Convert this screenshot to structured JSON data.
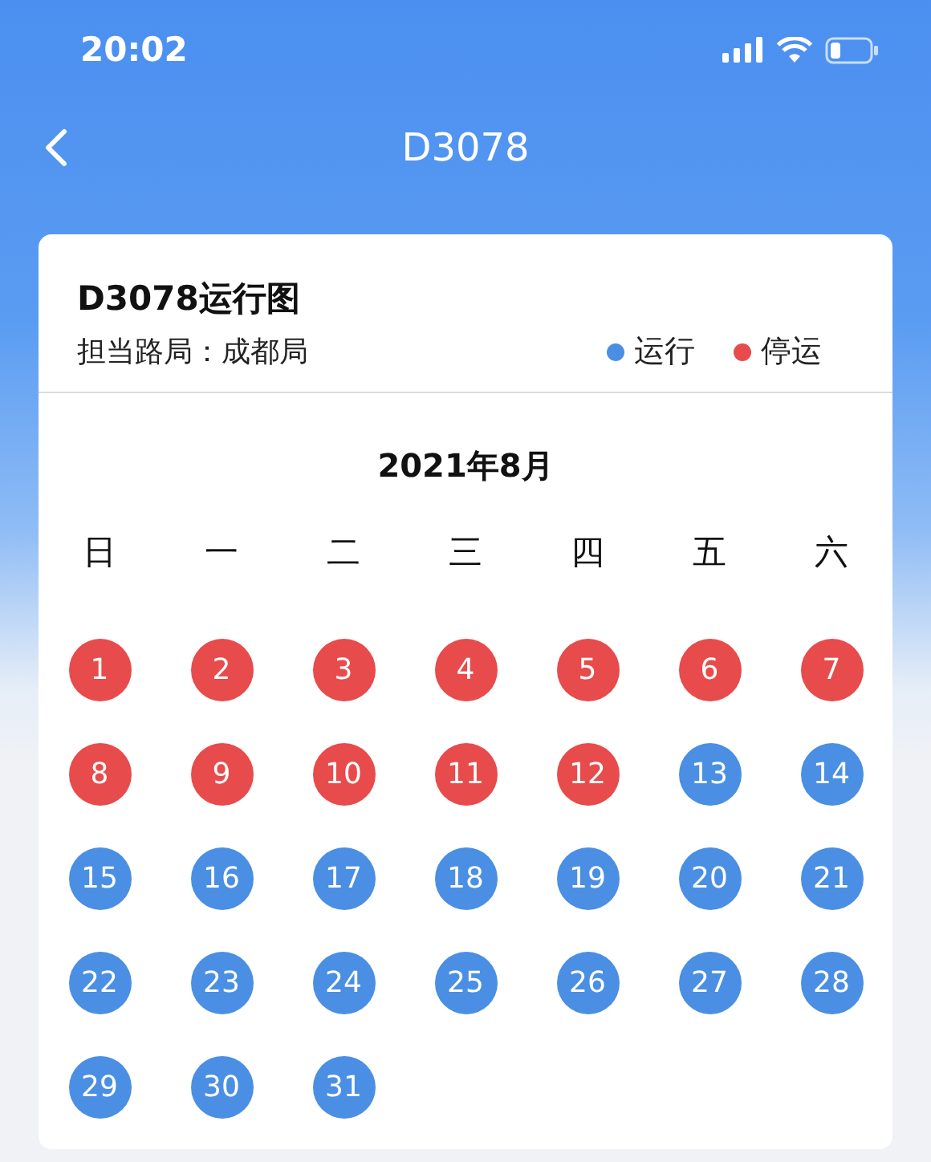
{
  "status_bar": {
    "time": "20:02"
  },
  "nav": {
    "title": "D3078"
  },
  "card": {
    "title": "D3078运行图",
    "bureau": "担当路局：成都局",
    "legend": [
      {
        "label": "运行",
        "color": "#4a8fe3"
      },
      {
        "label": "停运",
        "color": "#e84b4b"
      }
    ]
  },
  "calendar": {
    "month": "2021年8月",
    "weekdays": [
      "日",
      "一",
      "二",
      "三",
      "四",
      "五",
      "六"
    ],
    "days": [
      {
        "label": "1",
        "color": "#e84b4b"
      },
      {
        "label": "2",
        "color": "#e84b4b"
      },
      {
        "label": "3",
        "color": "#e84b4b"
      },
      {
        "label": "4",
        "color": "#e84b4b"
      },
      {
        "label": "5",
        "color": "#e84b4b"
      },
      {
        "label": "6",
        "color": "#e84b4b"
      },
      {
        "label": "7",
        "color": "#e84b4b"
      },
      {
        "label": "8",
        "color": "#e84b4b"
      },
      {
        "label": "9",
        "color": "#e84b4b"
      },
      {
        "label": "10",
        "color": "#e84b4b"
      },
      {
        "label": "11",
        "color": "#e84b4b"
      },
      {
        "label": "12",
        "color": "#e84b4b"
      },
      {
        "label": "13",
        "color": "#4a8fe3"
      },
      {
        "label": "14",
        "color": "#4a8fe3"
      },
      {
        "label": "15",
        "color": "#4a8fe3"
      },
      {
        "label": "16",
        "color": "#4a8fe3"
      },
      {
        "label": "17",
        "color": "#4a8fe3"
      },
      {
        "label": "18",
        "color": "#4a8fe3"
      },
      {
        "label": "19",
        "color": "#4a8fe3"
      },
      {
        "label": "20",
        "color": "#4a8fe3"
      },
      {
        "label": "21",
        "color": "#4a8fe3"
      },
      {
        "label": "22",
        "color": "#4a8fe3"
      },
      {
        "label": "23",
        "color": "#4a8fe3"
      },
      {
        "label": "24",
        "color": "#4a8fe3"
      },
      {
        "label": "25",
        "color": "#4a8fe3"
      },
      {
        "label": "26",
        "color": "#4a8fe3"
      },
      {
        "label": "27",
        "color": "#4a8fe3"
      },
      {
        "label": "28",
        "color": "#4a8fe3"
      },
      {
        "label": "29",
        "color": "#4a8fe3"
      },
      {
        "label": "30",
        "color": "#4a8fe3"
      },
      {
        "label": "31",
        "color": "#4a8fe3"
      }
    ]
  }
}
